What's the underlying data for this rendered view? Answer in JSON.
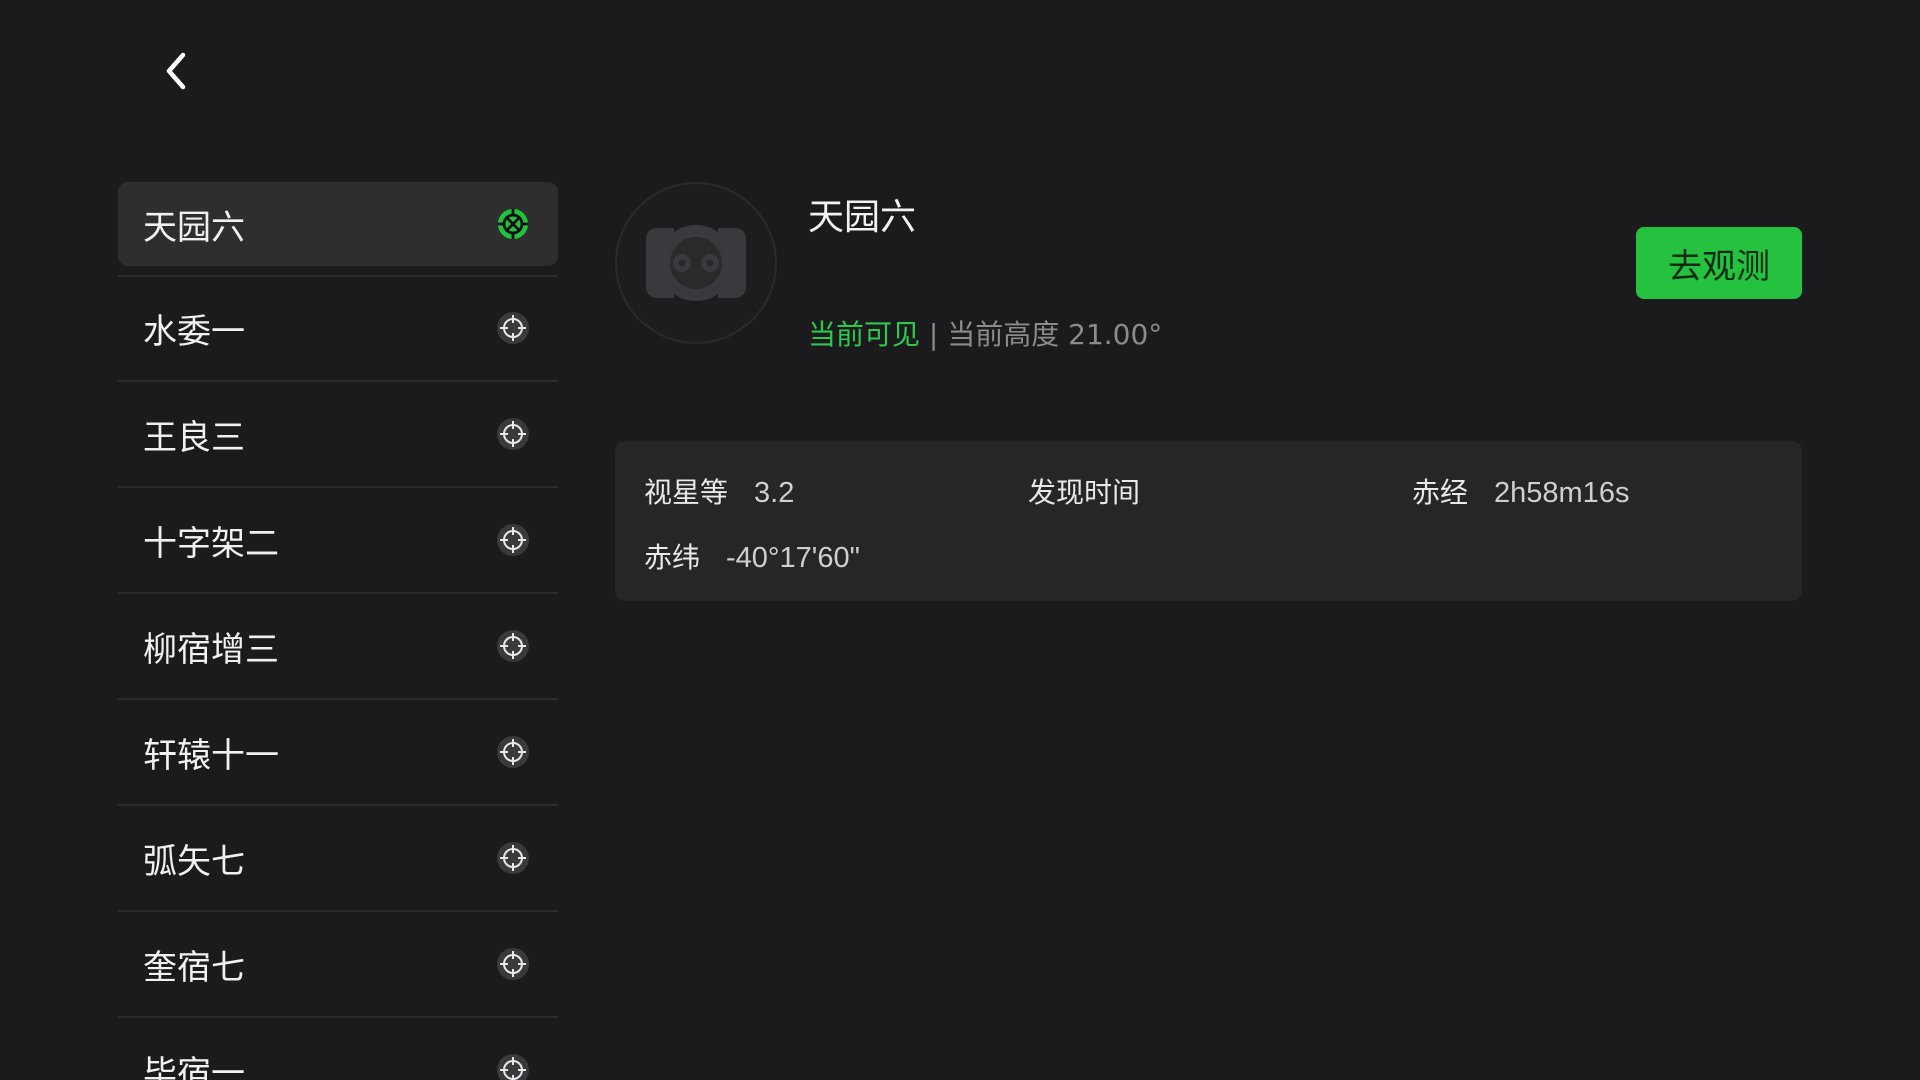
{
  "nav": {
    "back_icon": "chevron-left-icon"
  },
  "sidebar": {
    "items": [
      {
        "label": "天园六",
        "icon": "target-icon",
        "selected": true
      },
      {
        "label": "水委一",
        "icon": "target-icon",
        "selected": false
      },
      {
        "label": "王良三",
        "icon": "target-icon",
        "selected": false
      },
      {
        "label": "十字架二",
        "icon": "target-icon",
        "selected": false
      },
      {
        "label": "柳宿增三",
        "icon": "target-icon",
        "selected": false
      },
      {
        "label": "轩辕十一",
        "icon": "target-icon",
        "selected": false
      },
      {
        "label": "弧矢七",
        "icon": "target-icon",
        "selected": false
      },
      {
        "label": "奎宿七",
        "icon": "target-icon",
        "selected": false
      },
      {
        "label": "毕宿一",
        "icon": "target-icon",
        "selected": false
      }
    ]
  },
  "detail": {
    "title": "天园六",
    "status_visible": "当前可见",
    "status_separator": " | ",
    "status_altitude": "当前高度 21.00°",
    "observe_button": "去观测",
    "info": {
      "magnitude_label": "视星等",
      "magnitude_value": "3.2",
      "discovery_label": "发现时间",
      "discovery_value": "",
      "ra_label": "赤经",
      "ra_value": "2h58m16s",
      "dec_label": "赤纬",
      "dec_value": "-40°17'60\""
    }
  },
  "colors": {
    "background": "#1b1b1d",
    "accent_green": "#25c23f",
    "card": "#262628"
  }
}
